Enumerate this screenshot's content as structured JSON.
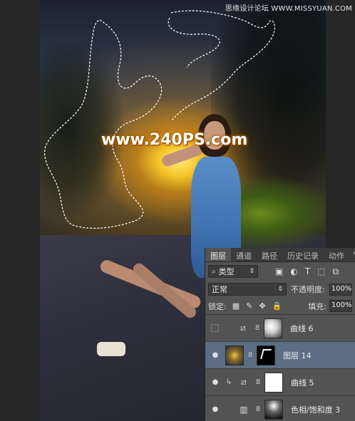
{
  "watermark": {
    "top_right": "思缘设计论坛 WWW.MISSYUAN.COM",
    "center": "www.240PS.com"
  },
  "layers_panel": {
    "tabs": [
      {
        "label": "图层",
        "active": true
      },
      {
        "label": "通道",
        "active": false
      },
      {
        "label": "路径",
        "active": false
      },
      {
        "label": "历史记录",
        "active": false
      },
      {
        "label": "动作",
        "active": false
      }
    ],
    "more": "»",
    "kind_filter": {
      "icon": "search-icon",
      "value": "类型",
      "arrow": "⇕"
    },
    "filter_icons": [
      "image-icon",
      "adjustment-icon",
      "text-icon",
      "shape-icon",
      "smart-object-icon"
    ],
    "blend_mode": {
      "value": "正常",
      "arrow": "⇕"
    },
    "opacity": {
      "label": "不透明度:",
      "value": "100%"
    },
    "lock": {
      "label": "锁定:"
    },
    "lock_icons": [
      "lock-transparent-icon",
      "lock-brush-icon",
      "lock-move-icon",
      "lock-all-icon"
    ],
    "fill": {
      "label": "填充:",
      "value": "100%"
    },
    "layers": [
      {
        "name": "曲线 6",
        "visible": false,
        "selected": false,
        "adjustment": "curves-icon",
        "mask": "mask1"
      },
      {
        "name": "图层 14",
        "visible": true,
        "selected": true,
        "adjustment": "",
        "mask": "mask2"
      },
      {
        "name": "曲线 5",
        "visible": true,
        "selected": false,
        "adjustment": "curves-icon",
        "mask": "white",
        "clipped": true
      },
      {
        "name": "色相/饱和度 3",
        "visible": true,
        "selected": false,
        "adjustment": "hue-saturation-icon",
        "mask": "mask3"
      }
    ]
  },
  "colors": {
    "panel_bg": "#535353",
    "selected_row": "#5d6d83",
    "glow": "#f5c84a"
  }
}
